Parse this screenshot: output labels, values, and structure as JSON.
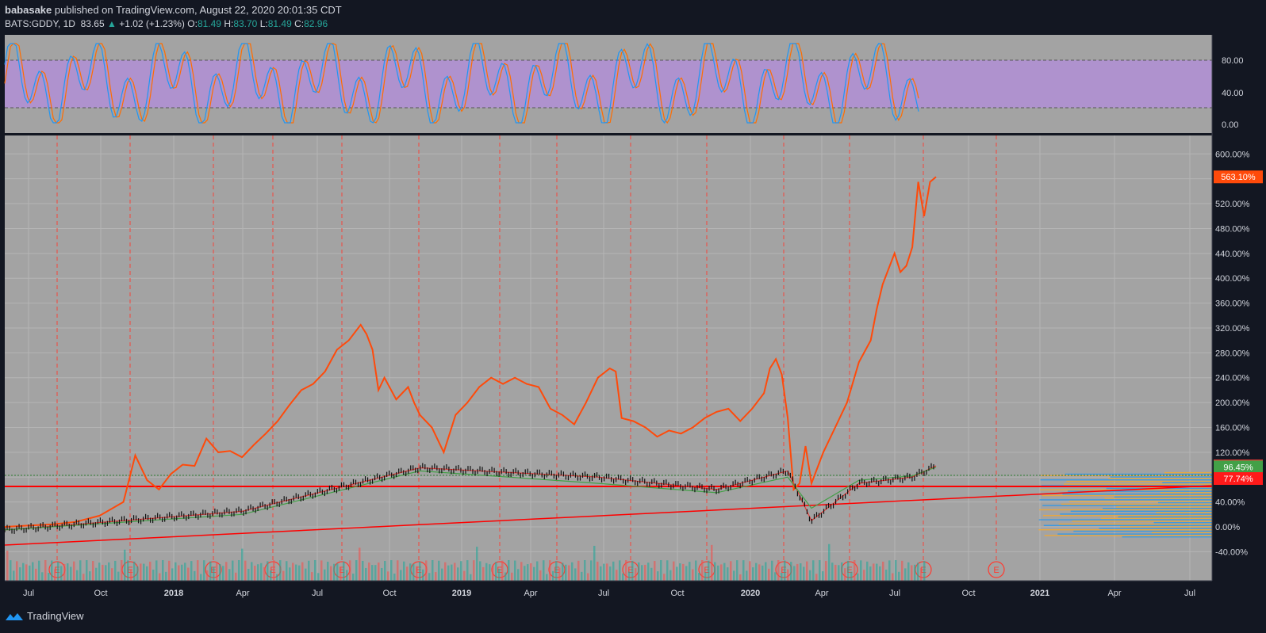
{
  "header": {
    "author": "babasake",
    "published_text": "published on TradingView.com, August 22, 2020 20:01:35 CDT",
    "symbol": "BATS:GDDY, 1D",
    "last": "83.65",
    "change": "+1.02 (+1.23%)",
    "o_label": "O:",
    "o": "81.49",
    "h_label": "H:",
    "h": "83.70",
    "l_label": "L:",
    "l": "81.49",
    "c_label": "C:",
    "c": "82.96"
  },
  "footer": {
    "brand": "TradingView"
  },
  "colors": {
    "background": "#131722",
    "plot_bg": "#a3a3a3",
    "compare_line": "#ff4a0a",
    "stoch_k": "#2196f3",
    "stoch_d": "#ff6d00",
    "stoch_band": "#b48ae0",
    "support": "#ff0000",
    "earnings": "#ff3b30"
  },
  "chart_data": {
    "type": "line",
    "stochastic": {
      "y_ticks": [
        "80.00",
        "40.00",
        "0.00"
      ],
      "band": [
        20,
        80
      ]
    },
    "y_ticks": [
      "600.00%",
      "560.00%",
      "520.00%",
      "480.00%",
      "440.00%",
      "400.00%",
      "360.00%",
      "320.00%",
      "280.00%",
      "240.00%",
      "200.00%",
      "160.00%",
      "120.00%",
      "80.00%",
      "40.00%",
      "0.00%",
      "-40.00%"
    ],
    "y_values": [
      600,
      560,
      520,
      480,
      440,
      400,
      360,
      320,
      280,
      240,
      200,
      160,
      120,
      80,
      40,
      0,
      -40
    ],
    "x_ticks": [
      "Jul",
      "Oct",
      "2018",
      "Apr",
      "Jul",
      "Oct",
      "2019",
      "Apr",
      "Jul",
      "Oct",
      "2020",
      "Apr",
      "Jul",
      "Oct",
      "2021",
      "Apr",
      "Jul"
    ],
    "price_badges": [
      {
        "label": "563.10%",
        "value": 563.1,
        "color": "#ff4a0a"
      },
      {
        "label": "98.08%",
        "value": 98.08,
        "color": "#e53935"
      },
      {
        "label": "96.45%",
        "value": 96.45,
        "color": "#43a047"
      },
      {
        "label": "77.74%",
        "value": 77.74,
        "color": "#ff1a1a"
      }
    ],
    "earnings_marker": "E",
    "series": [
      {
        "points": [
          [
            0,
            0
          ],
          [
            0.02,
            2
          ],
          [
            0.04,
            4
          ],
          [
            0.06,
            8
          ],
          [
            0.08,
            18
          ],
          [
            0.1,
            40
          ],
          [
            0.11,
            115
          ],
          [
            0.12,
            75
          ],
          [
            0.13,
            60
          ],
          [
            0.14,
            85
          ],
          [
            0.15,
            100
          ],
          [
            0.16,
            98
          ],
          [
            0.17,
            142
          ],
          [
            0.18,
            120
          ],
          [
            0.19,
            122
          ],
          [
            0.2,
            112
          ],
          [
            0.21,
            132
          ],
          [
            0.22,
            150
          ],
          [
            0.23,
            170
          ],
          [
            0.24,
            196
          ],
          [
            0.25,
            220
          ],
          [
            0.26,
            230
          ],
          [
            0.27,
            250
          ],
          [
            0.28,
            285
          ],
          [
            0.29,
            300
          ],
          [
            0.3,
            325
          ],
          [
            0.305,
            310
          ],
          [
            0.31,
            285
          ],
          [
            0.315,
            220
          ],
          [
            0.32,
            240
          ],
          [
            0.33,
            205
          ],
          [
            0.34,
            225
          ],
          [
            0.345,
            200
          ],
          [
            0.35,
            180
          ],
          [
            0.36,
            160
          ],
          [
            0.37,
            120
          ],
          [
            0.38,
            180
          ],
          [
            0.39,
            200
          ],
          [
            0.4,
            225
          ],
          [
            0.41,
            240
          ],
          [
            0.42,
            230
          ],
          [
            0.43,
            240
          ],
          [
            0.44,
            230
          ],
          [
            0.45,
            225
          ],
          [
            0.46,
            190
          ],
          [
            0.47,
            180
          ],
          [
            0.48,
            165
          ],
          [
            0.49,
            200
          ],
          [
            0.5,
            240
          ],
          [
            0.51,
            255
          ],
          [
            0.515,
            250
          ],
          [
            0.52,
            175
          ],
          [
            0.53,
            170
          ],
          [
            0.54,
            160
          ],
          [
            0.55,
            145
          ],
          [
            0.56,
            155
          ],
          [
            0.57,
            150
          ],
          [
            0.58,
            160
          ],
          [
            0.59,
            175
          ],
          [
            0.6,
            185
          ],
          [
            0.61,
            190
          ],
          [
            0.62,
            170
          ],
          [
            0.63,
            190
          ],
          [
            0.64,
            215
          ],
          [
            0.645,
            255
          ],
          [
            0.65,
            270
          ],
          [
            0.655,
            245
          ],
          [
            0.66,
            175
          ],
          [
            0.665,
            60
          ],
          [
            0.67,
            70
          ],
          [
            0.675,
            130
          ],
          [
            0.68,
            70
          ],
          [
            0.69,
            120
          ],
          [
            0.7,
            160
          ],
          [
            0.71,
            200
          ],
          [
            0.72,
            265
          ],
          [
            0.73,
            300
          ],
          [
            0.735,
            350
          ],
          [
            0.74,
            390
          ],
          [
            0.75,
            440
          ],
          [
            0.755,
            410
          ],
          [
            0.76,
            420
          ],
          [
            0.765,
            450
          ],
          [
            0.77,
            555
          ],
          [
            0.775,
            500
          ],
          [
            0.78,
            555
          ],
          [
            0.785,
            563
          ]
        ]
      },
      {
        "points": [
          [
            0,
            -5
          ],
          [
            0.2,
            25
          ],
          [
            0.35,
            95
          ],
          [
            0.5,
            80
          ],
          [
            0.6,
            60
          ],
          [
            0.66,
            90
          ],
          [
            0.68,
            10
          ],
          [
            0.72,
            70
          ],
          [
            0.765,
            80
          ],
          [
            0.785,
            98
          ]
        ]
      },
      {
        "points": [
          [
            0,
            -5
          ],
          [
            0.2,
            20
          ],
          [
            0.35,
            90
          ],
          [
            0.5,
            70
          ],
          [
            0.6,
            55
          ],
          [
            0.66,
            80
          ],
          [
            0.68,
            30
          ],
          [
            0.72,
            75
          ],
          [
            0.765,
            82
          ],
          [
            0.785,
            96
          ]
        ]
      }
    ]
  }
}
